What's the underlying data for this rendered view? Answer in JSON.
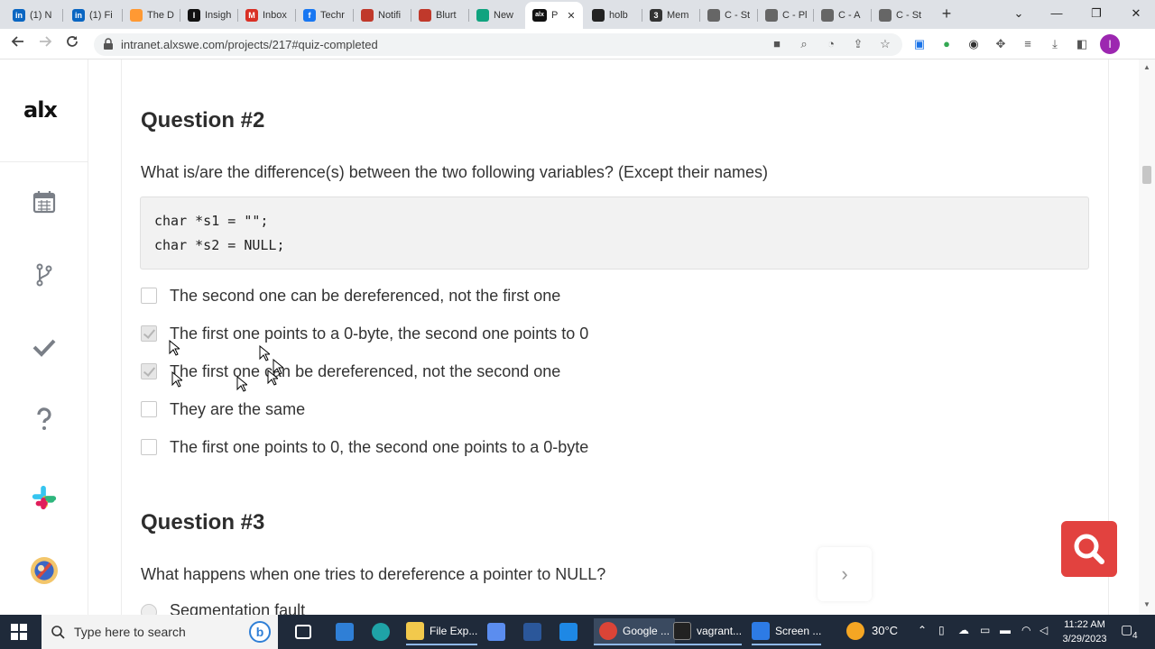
{
  "browser": {
    "tabs": [
      {
        "label": "(1) N",
        "color": "#0a66c2",
        "glyph": "in"
      },
      {
        "label": "(1) Fi",
        "color": "#0a66c2",
        "glyph": "in"
      },
      {
        "label": "The D",
        "color": "#ff9933",
        "glyph": ""
      },
      {
        "label": "Insigh",
        "color": "#111111",
        "glyph": "I"
      },
      {
        "label": "Inbox",
        "color": "#d93025",
        "glyph": "M"
      },
      {
        "label": "Techr",
        "color": "#1877f2",
        "glyph": "f"
      },
      {
        "label": "Notifi",
        "color": "#c0392b",
        "glyph": ""
      },
      {
        "label": "Blurt",
        "color": "#c0392b",
        "glyph": ""
      },
      {
        "label": "New",
        "color": "#10a37f",
        "glyph": ""
      },
      {
        "label": "P",
        "color": "#111111",
        "glyph": "alx",
        "active": true
      },
      {
        "label": "holb",
        "color": "#222222",
        "glyph": ""
      },
      {
        "label": "Mem",
        "color": "#333333",
        "glyph": "3"
      },
      {
        "label": "C - St",
        "color": "#666666",
        "glyph": ""
      },
      {
        "label": "C - Pl",
        "color": "#666666",
        "glyph": ""
      },
      {
        "label": "C - A",
        "color": "#666666",
        "glyph": ""
      },
      {
        "label": "C - St",
        "color": "#666666",
        "glyph": ""
      }
    ],
    "new_tab": "+",
    "close_tab": "✕",
    "url": "intranet.alxswe.com/projects/217#quiz-completed",
    "window_controls": {
      "minimize": "—",
      "maximize": "❐",
      "close": "✕",
      "dropdown": "⌄"
    },
    "profile_initial": "I"
  },
  "sidebar": {
    "logo": "alx"
  },
  "quiz": {
    "q2": {
      "title": "Question #2",
      "text": "What is/are the difference(s) between the two following variables? (Except their names)",
      "code": [
        "char *s1 = \"\";",
        "char *s2 = NULL;"
      ],
      "options": [
        {
          "label": "The second one can be dereferenced, not the first one",
          "checked": false
        },
        {
          "label": "The first one points to a 0-byte, the second one points to 0",
          "checked": true
        },
        {
          "label": "The first one can be dereferenced, not the second one",
          "checked": true
        },
        {
          "label": "They are the same",
          "checked": false
        },
        {
          "label": "The first one points to 0, the second one points to a 0-byte",
          "checked": false
        }
      ]
    },
    "q3": {
      "title": "Question #3",
      "text": "What happens when one tries to dereference a pointer to NULL?",
      "first_option": "Segmentation fault"
    }
  },
  "next_arrow": "›",
  "taskbar": {
    "search_placeholder": "Type here to search",
    "apps": [
      {
        "label": "File Exp...",
        "color": "#f2c94c"
      },
      {
        "label": "Google ...",
        "color": "#db4437"
      },
      {
        "label": "vagrant...",
        "color": "#222222"
      },
      {
        "label": "Screen ...",
        "color": "#2d7be5"
      }
    ],
    "weather": "30°C",
    "time": "11:22 AM",
    "date": "3/29/2023",
    "notification_count": "4"
  }
}
